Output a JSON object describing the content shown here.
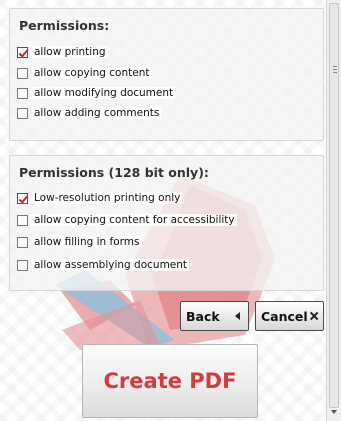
{
  "permissions": {
    "title": "Permissions:",
    "options": [
      {
        "label": "allow printing",
        "checked": true
      },
      {
        "label": "allow copying content",
        "checked": false
      },
      {
        "label": "allow modifying document",
        "checked": false
      },
      {
        "label": "allow adding comments",
        "checked": false
      }
    ]
  },
  "permissions128": {
    "title": "Permissions (128 bit only):",
    "options": [
      {
        "label": "Low-resolution printing only",
        "checked": true
      },
      {
        "label": "allow copying content for accessibility",
        "checked": false
      },
      {
        "label": "allow filling in forms",
        "checked": false
      },
      {
        "label": "allow assemblying document",
        "checked": false
      }
    ]
  },
  "buttons": {
    "back": "Back",
    "cancel": "Cancel",
    "create": "Create PDF"
  },
  "colors": {
    "accent_red": "#d23b40",
    "check_red": "#c0262c",
    "logo_blue": "#7fb7d6"
  },
  "icons": {
    "back": "left-triangle-icon",
    "cancel": "close-x-icon"
  }
}
